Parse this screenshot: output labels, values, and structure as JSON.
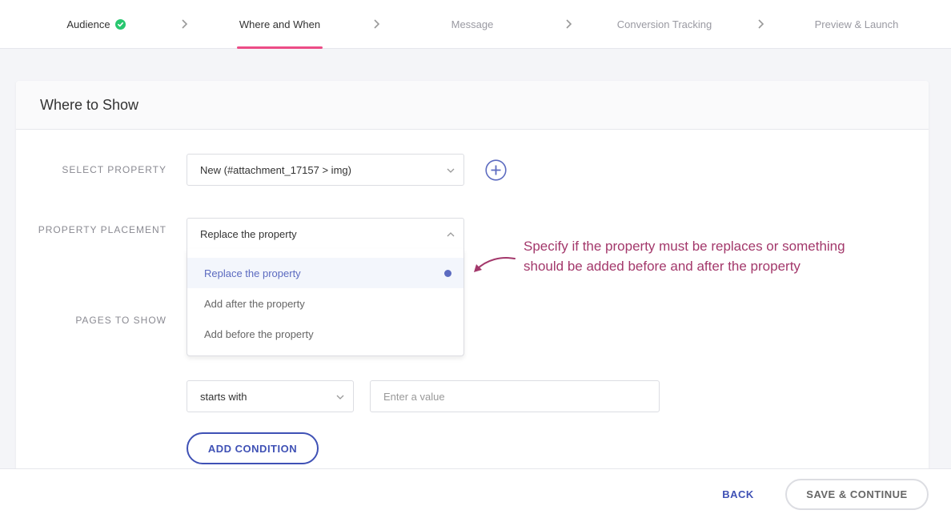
{
  "stepper": {
    "steps": [
      {
        "label": "Audience",
        "state": "done"
      },
      {
        "label": "Where and When",
        "state": "active"
      },
      {
        "label": "Message",
        "state": "pending"
      },
      {
        "label": "Conversion Tracking",
        "state": "pending"
      },
      {
        "label": "Preview & Launch",
        "state": "pending"
      }
    ]
  },
  "card": {
    "title": "Where to Show",
    "select_property": {
      "label": "SELECT PROPERTY",
      "value": "New (#attachment_17157 > img)"
    },
    "property_placement": {
      "label": "PROPERTY PLACEMENT",
      "value": "Replace the property",
      "options": [
        {
          "label": "Replace the property",
          "selected": true
        },
        {
          "label": "Add after the property",
          "selected": false
        },
        {
          "label": "Add before the property",
          "selected": false
        }
      ]
    },
    "pages_to_show": {
      "label": "PAGES TO SHOW",
      "condition": "starts with",
      "value_placeholder": "Enter a value"
    },
    "add_condition_label": "ADD CONDITION"
  },
  "annotation": {
    "text": "Specify if the property must be replaces or something should be added before and after the property"
  },
  "footer": {
    "back_label": "BACK",
    "save_label": "SAVE & CONTINUE"
  },
  "colors": {
    "accent": "#3f51b5",
    "active_underline": "#ec4d86",
    "success": "#28c76f",
    "annotation": "#a3386b"
  }
}
